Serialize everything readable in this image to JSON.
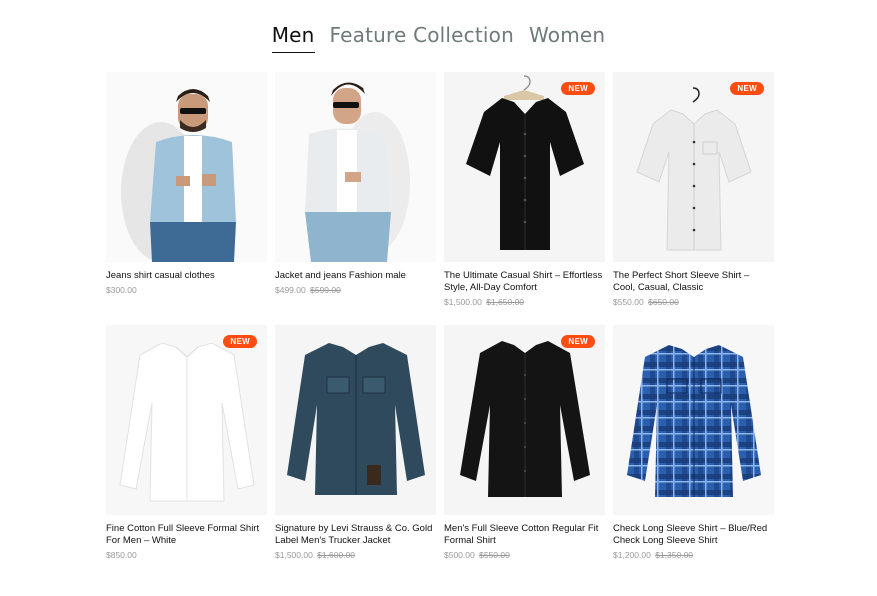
{
  "tabs": [
    {
      "label": "Men",
      "active": true
    },
    {
      "label": "Feature Collection",
      "active": false
    },
    {
      "label": "Women",
      "active": false
    }
  ],
  "products": [
    {
      "title": "Jeans shirt casual clothes",
      "price": "$300.00",
      "old_price": "",
      "badge": "",
      "image": "man-denim-jacket-photo"
    },
    {
      "title": "Jacket and jeans Fashion male",
      "price": "$499.00",
      "old_price": "$599.00",
      "badge": "",
      "image": "man-light-jacket-photo"
    },
    {
      "title": "The Ultimate Casual Shirt – Effortless Style, All-Day Comfort",
      "price": "$1,500.00",
      "old_price": "$1,650.00",
      "badge": "NEW",
      "image": "black-short-sleeve-shirt"
    },
    {
      "title": "The Perfect Short Sleeve Shirt – Cool, Casual, Classic",
      "price": "$550.00",
      "old_price": "$650.00",
      "badge": "NEW",
      "image": "white-short-sleeve-shirt"
    },
    {
      "title": "Fine Cotton Full Sleeve Formal Shirt For Men – White",
      "price": "$850.00",
      "old_price": "",
      "badge": "NEW",
      "image": "white-formal-shirt"
    },
    {
      "title": "Signature by Levi Strauss & Co. Gold Label Men's Trucker Jacket",
      "price": "$1,500.00",
      "old_price": "$1,600.00",
      "badge": "",
      "image": "denim-trucker-jacket"
    },
    {
      "title": "Men's Full Sleeve Cotton Regular Fit Formal Shirt",
      "price": "$500.00",
      "old_price": "$550.00",
      "badge": "NEW",
      "image": "black-formal-shirt"
    },
    {
      "title": "Check Long Sleeve Shirt – Blue/Red Check Long Sleeve Shirt",
      "price": "$1,200.00",
      "old_price": "$1,350.00",
      "badge": "",
      "image": "blue-check-shirt"
    }
  ],
  "colors": {
    "badge": "#ff4d12",
    "tab_inactive": "#6f7a7a",
    "thumb_bg": "#f5f5f5"
  }
}
